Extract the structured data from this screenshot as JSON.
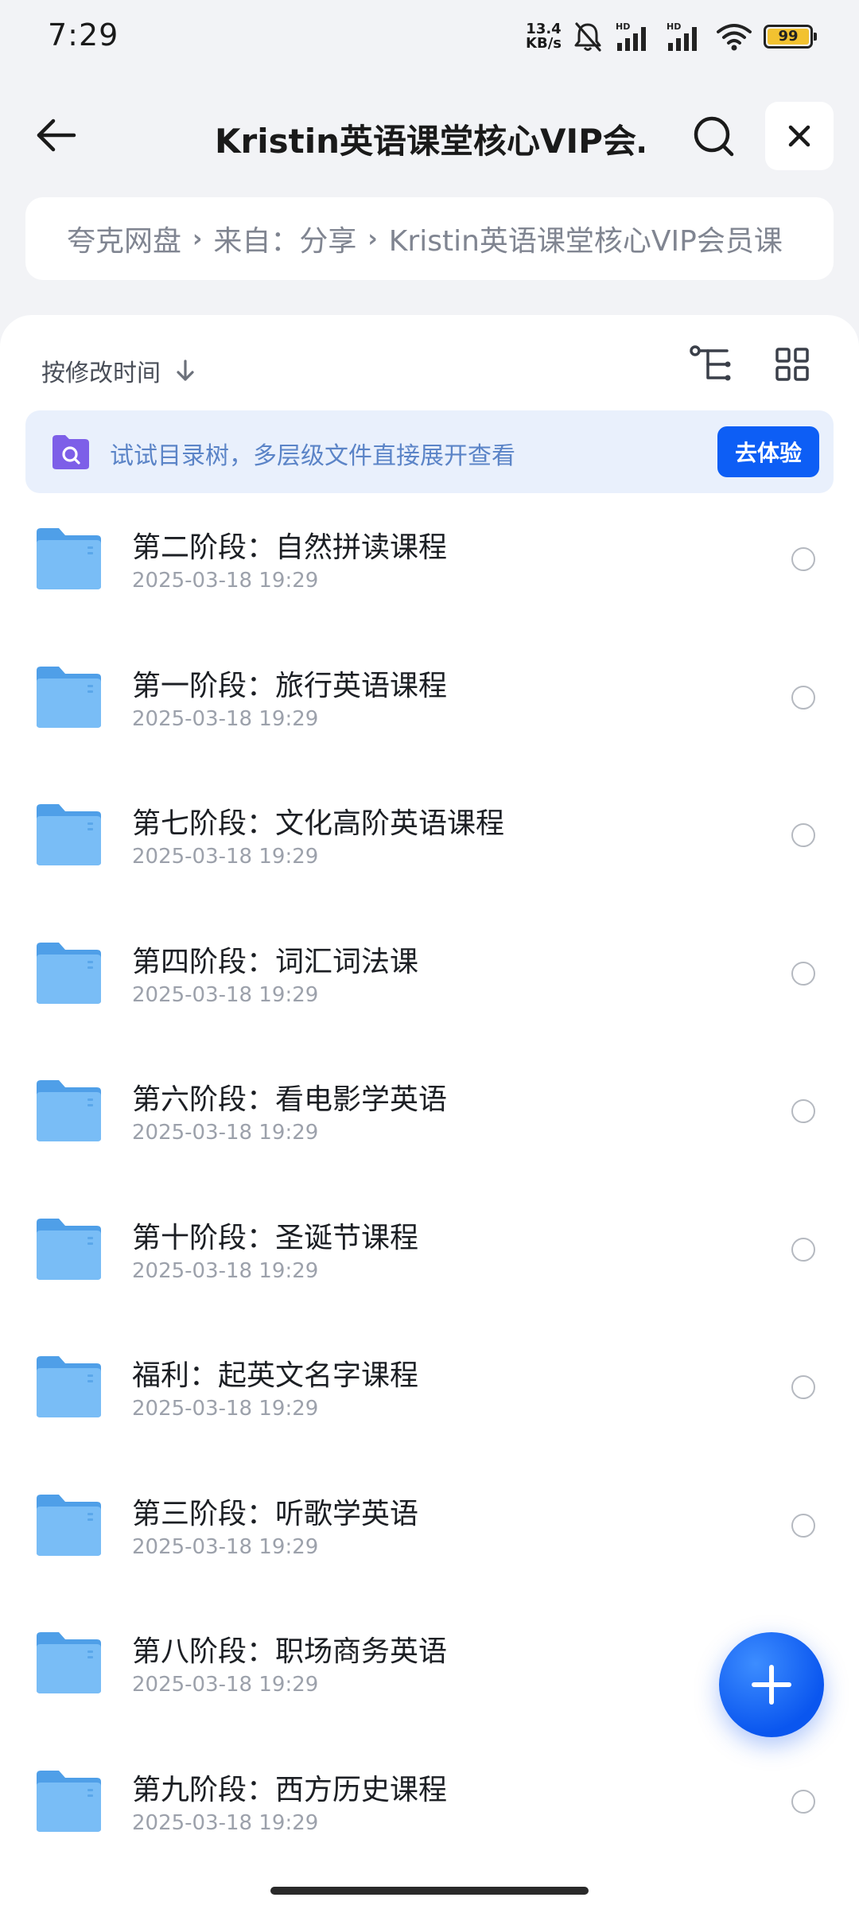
{
  "status_bar": {
    "time": "7:29",
    "net_speed_value": "13.4",
    "net_speed_unit": "KB/s",
    "battery": "99",
    "icons": [
      "mute-bell-icon",
      "signal-hd-icon",
      "signal-hd-icon",
      "wifi-icon",
      "battery-icon"
    ]
  },
  "header": {
    "title": "Kristin英语课堂核心VIP会…",
    "back_icon": "back-arrow-icon",
    "search_icon": "search-icon",
    "close_icon": "close-icon"
  },
  "breadcrumb": {
    "items": [
      "夸克网盘",
      "来自：分享",
      "Kristin英语课堂核心VIP会员课"
    ],
    "separator": "›"
  },
  "toolbar": {
    "sort_label": "按修改时间",
    "sort_icon": "arrow-down-icon",
    "tree_icon": "tree-view-icon",
    "grid_icon": "grid-view-icon"
  },
  "banner": {
    "text": "试试目录树，多层级文件直接展开查看",
    "button_label": "去体验",
    "icon": "folder-search-icon"
  },
  "files": [
    {
      "name": "第二阶段：自然拼读课程",
      "date": "2025-03-18 19:29"
    },
    {
      "name": "第一阶段：旅行英语课程",
      "date": "2025-03-18 19:29"
    },
    {
      "name": "第七阶段：文化高阶英语课程",
      "date": "2025-03-18 19:29"
    },
    {
      "name": "第四阶段：词汇词法课",
      "date": "2025-03-18 19:29"
    },
    {
      "name": "第六阶段：看电影学英语",
      "date": "2025-03-18 19:29"
    },
    {
      "name": "第十阶段：圣诞节课程",
      "date": "2025-03-18 19:29"
    },
    {
      "name": "福利：起英文名字课程",
      "date": "2025-03-18 19:29"
    },
    {
      "name": "第三阶段：听歌学英语",
      "date": "2025-03-18 19:29"
    },
    {
      "name": "第八阶段：职场商务英语",
      "date": "2025-03-18 19:29"
    },
    {
      "name": "第九阶段：西方历史课程",
      "date": "2025-03-18 19:29"
    }
  ],
  "fab": {
    "icon": "plus-icon"
  },
  "colors": {
    "accent": "#0d5ef5",
    "banner_bg": "#e9f0fc",
    "folder": "#5aaaf0",
    "background": "#f2f3f6"
  }
}
